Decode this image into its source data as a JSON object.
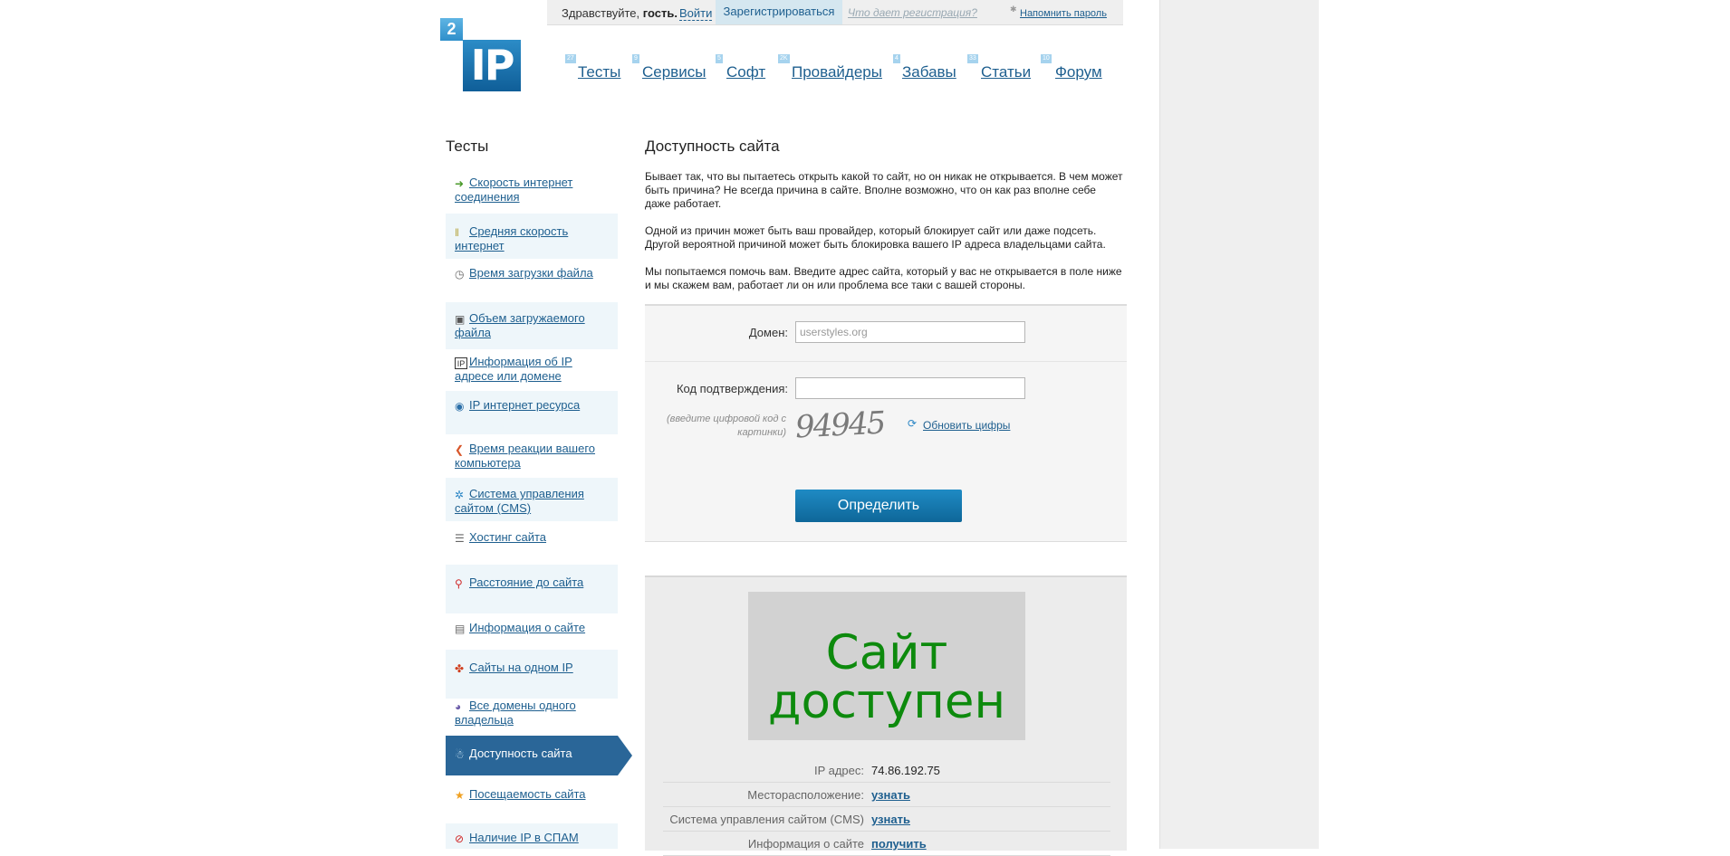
{
  "topbar": {
    "greeting": "Здравствуйте,",
    "guest": "гость.",
    "login": "Войти",
    "register": "Зарегистрироваться",
    "why_register": "Что дает регистрация?",
    "remind_password": "Напомнить пароль"
  },
  "logo": {
    "badge": "2",
    "text": "IP"
  },
  "nav": [
    {
      "label": "Тесты",
      "count": "27"
    },
    {
      "label": "Сервисы",
      "count": "9"
    },
    {
      "label": "Софт",
      "count": "5"
    },
    {
      "label": "Провайдеры",
      "count": "2K"
    },
    {
      "label": "Забавы",
      "count": "4"
    },
    {
      "label": "Статьи",
      "count": "33"
    },
    {
      "label": "Форум",
      "count": "10"
    }
  ],
  "sidebar": {
    "title": "Тесты",
    "items": [
      {
        "label": "Скорость интернет соединения",
        "icon": "speed-arrow-icon"
      },
      {
        "label": "Средняя скорость интернет",
        "icon": "bars-icon"
      },
      {
        "label": "Время загрузки файла",
        "icon": "clock-icon"
      },
      {
        "label": "Объем загружаемого файла",
        "icon": "file-size-icon"
      },
      {
        "label": "Информация об IP адресе или домене",
        "icon": "ip-info-icon"
      },
      {
        "label": "IP интернет ресурса",
        "icon": "ip-globe-icon"
      },
      {
        "label": "Время реакции вашего компьютера",
        "icon": "reaction-icon"
      },
      {
        "label": "Система управления сайтом (CMS)",
        "icon": "cms-gear-icon"
      },
      {
        "label": "Хостинг сайта",
        "icon": "server-icon"
      },
      {
        "label": "Расстояние до сайта",
        "icon": "map-pin-icon"
      },
      {
        "label": "Информация о сайте",
        "icon": "site-info-icon"
      },
      {
        "label": "Сайты на одном IP",
        "icon": "shared-ip-icon"
      },
      {
        "label": "Все домены одного владельца",
        "icon": "owner-domains-icon"
      },
      {
        "label": "Доступность сайта",
        "icon": "availability-icon"
      },
      {
        "label": "Посещаемость сайта",
        "icon": "star-icon"
      },
      {
        "label": "Наличие IP в СПАМ",
        "icon": "spam-icon"
      }
    ]
  },
  "main": {
    "title": "Доступность сайта",
    "paragraphs": [
      "Бывает так, что вы пытаетесь открыть какой то сайт, но он никак не открывается. В чем может быть причина? Не всегда причина в сайте. Вполне возможно, что он как раз вполне себе даже работает.",
      "Одной из причин может быть ваш провайдер, который блокирует сайт или даже подсеть. Другой вероятной причиной может быть блокировка вашего IP адреса владельцами сайта.",
      "Мы попытаемся помочь вам. Введите адрес сайта, который у вас не открывается в поле ниже и мы скажем вам, работает ли он или проблема все таки с вашей  стороны."
    ],
    "form": {
      "domain_label": "Домен:",
      "domain_value": "userstyles.org",
      "code_label": "Код подтверждения:",
      "code_value": "",
      "captcha_hint": "(введите цифровой код с картинки)",
      "captcha_text": "94945",
      "refresh_label": "Обновить цифры",
      "submit_label": "Определить"
    },
    "result": {
      "status_line1": "Сайт",
      "status_line2": "доступен",
      "status_color": "#0d8a0d",
      "rows": [
        {
          "key": "IP адрес:",
          "value": "74.86.192.75"
        },
        {
          "key": "Месторасположение:",
          "value": "узнать"
        },
        {
          "key": "Система управления сайтом (CMS)",
          "value": "узнать"
        },
        {
          "key": "Информация о сайте",
          "value": "получить"
        }
      ]
    }
  }
}
